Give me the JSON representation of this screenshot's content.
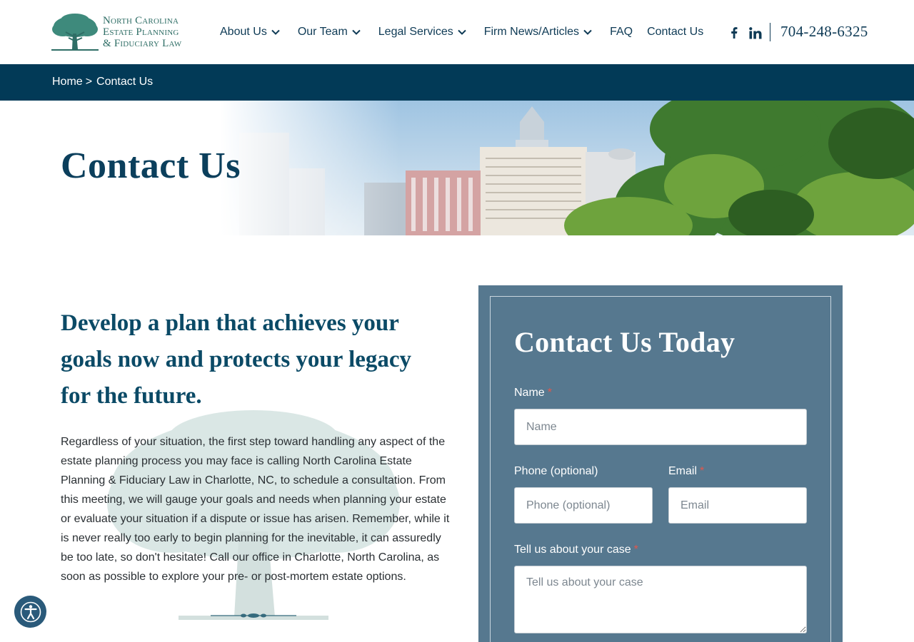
{
  "brand": {
    "logo_line1": "North Carolina",
    "logo_line2": "Estate Planning",
    "logo_line3": "& Fiduciary Law",
    "logo_icon": "oak-tree-icon"
  },
  "nav": {
    "items": [
      {
        "label": "About Us",
        "has_dropdown": true
      },
      {
        "label": "Our Team",
        "has_dropdown": true
      },
      {
        "label": "Legal Services",
        "has_dropdown": true
      },
      {
        "label": "Firm News/Articles",
        "has_dropdown": true
      },
      {
        "label": "FAQ",
        "has_dropdown": false
      },
      {
        "label": "Contact Us",
        "has_dropdown": false
      }
    ],
    "social": [
      "facebook-icon",
      "linkedin-icon"
    ],
    "phone": "704-248-6325"
  },
  "breadcrumb": {
    "home": "Home",
    "separator": ">",
    "current": "Contact Us"
  },
  "hero": {
    "title": "Contact Us"
  },
  "intro": {
    "heading": "Develop a plan that achieves your goals now and protects your legacy for the future.",
    "body": "Regardless of your situation, the first step toward handling any aspect of the estate planning process you may face is calling North Carolina Estate Planning & Fiduciary Law in Charlotte, NC, to schedule a consultation. From this meeting, we will gauge your goals and needs when planning your estate or evaluate your situation if a dispute or issue has arisen. Remember, while it is never really too early to begin planning for the inevitable, it can assuredly be too late, so don't hesitate! Call our office in Charlotte, North Carolina, as soon as possible to explore your pre- or post-mortem estate options."
  },
  "form": {
    "title": "Contact Us Today",
    "required_mark": "*",
    "name_label": "Name",
    "name_placeholder": "Name",
    "phone_label": "Phone (optional)",
    "phone_placeholder": "Phone (optional)",
    "email_label": "Email",
    "email_placeholder": "Email",
    "case_label": "Tell us about your case",
    "case_placeholder": "Tell us about your case"
  },
  "colors": {
    "navy": "#023a57",
    "heading_blue": "#0b4a66",
    "card_blue": "#56788f",
    "required_red": "#e2574c",
    "logo_green": "#2f6e66"
  },
  "accessibility": {
    "icon": "accessibility-icon"
  }
}
